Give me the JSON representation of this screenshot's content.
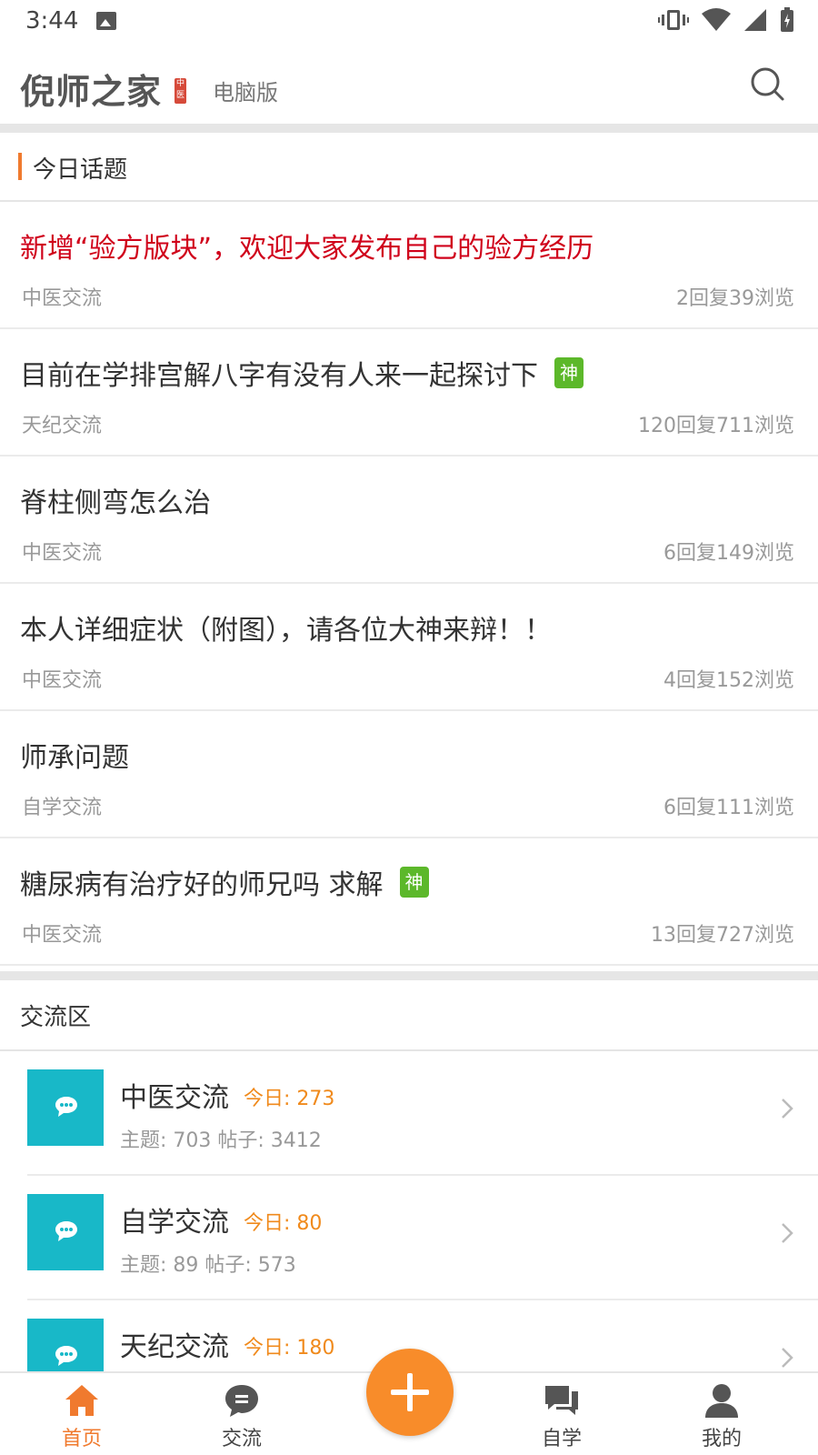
{
  "status_bar": {
    "time": "3:44"
  },
  "header": {
    "logo": "倪师之家",
    "logo_seal": "中医",
    "desktop_label": "电脑版"
  },
  "today_topics": {
    "title": "今日话题",
    "items": [
      {
        "title": "新增“验方版块”，欢迎大家发布自己的验方经历",
        "forum": "中医交流",
        "stats": "2回复39浏览",
        "hot": true,
        "badge": ""
      },
      {
        "title": "目前在学排宫解八字有没有人来一起探讨下",
        "forum": "天纪交流",
        "stats": "120回复711浏览",
        "hot": false,
        "badge": "神"
      },
      {
        "title": "脊柱侧弯怎么治",
        "forum": "中医交流",
        "stats": "6回复149浏览",
        "hot": false,
        "badge": ""
      },
      {
        "title": "本人详细症状（附图），请各位大神来辩！！",
        "forum": "中医交流",
        "stats": "4回复152浏览",
        "hot": false,
        "badge": ""
      },
      {
        "title": "师承问题",
        "forum": "自学交流",
        "stats": "6回复111浏览",
        "hot": false,
        "badge": ""
      },
      {
        "title": "糖尿病有治疗好的师兄吗 求解",
        "forum": "中医交流",
        "stats": "13回复727浏览",
        "hot": false,
        "badge": "神"
      }
    ]
  },
  "forum_area": {
    "title": "交流区",
    "items": [
      {
        "name": "中医交流",
        "today": "今日: 273",
        "meta": "主题: 703  帖子: 3412"
      },
      {
        "name": "自学交流",
        "today": "今日: 80",
        "meta": "主题: 89  帖子: 573"
      },
      {
        "name": "天纪交流",
        "today": "今日: 180",
        "meta": ""
      }
    ]
  },
  "tab_bar": {
    "tabs": [
      {
        "label": "首页",
        "icon": "home-icon",
        "active": true
      },
      {
        "label": "交流",
        "icon": "chat-bubble-icon",
        "active": false
      },
      {
        "label": "自学",
        "icon": "chat-bubbles-icon",
        "active": false
      },
      {
        "label": "我的",
        "icon": "user-icon",
        "active": false
      }
    ],
    "fab_icon": "plus-icon"
  },
  "colors": {
    "accent": "#f07a2e",
    "hot_title": "#d0021b",
    "badge_green": "#5cb82a",
    "forum_icon_bg": "#18b8c8",
    "today_orange": "#f08a1c"
  }
}
